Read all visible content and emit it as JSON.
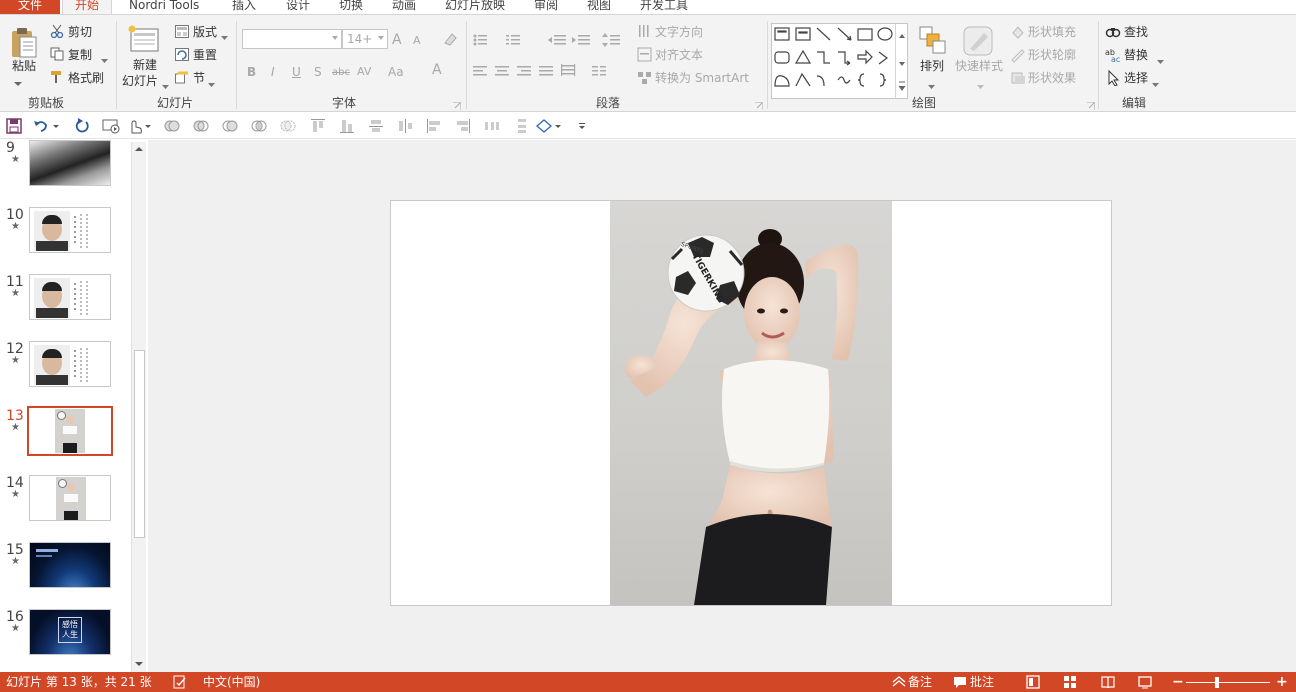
{
  "tabs": {
    "file": "文件",
    "home": "开始",
    "nordri": "Nordri Tools",
    "insert": "插入",
    "design": "设计",
    "transitions": "切换",
    "animations": "动画",
    "slideshow": "幻灯片放映",
    "review": "审阅",
    "view": "视图",
    "developer": "开发工具"
  },
  "clipboard": {
    "paste": "粘贴",
    "cut": "剪切",
    "copy": "复制",
    "format_painter": "格式刷",
    "group": "剪贴板"
  },
  "slides_group": {
    "new_slide_line1": "新建",
    "new_slide_line2": "幻灯片",
    "layout": "版式",
    "reset": "重置",
    "section": "节",
    "group": "幻灯片"
  },
  "font": {
    "size": "14+",
    "group": "字体",
    "bold": "B",
    "italic": "I",
    "underline": "U",
    "shadow": "S",
    "strike": "abc",
    "spacing": "AV",
    "case": "Aa",
    "color": "A",
    "grow": "A",
    "shrink": "A"
  },
  "paragraph": {
    "text_direction": "文字方向",
    "align_text": "对齐文本",
    "smartart": "转换为 SmartArt",
    "group": "段落"
  },
  "drawing": {
    "arrange": "排列",
    "quick_styles": "快速样式",
    "shape_fill": "形状填充",
    "shape_outline": "形状轮廓",
    "shape_effects": "形状效果",
    "group": "绘图"
  },
  "editing": {
    "find": "查找",
    "replace": "替换",
    "select": "选择",
    "group": "编辑"
  },
  "thumbnails": [
    {
      "num": "9",
      "star": "★",
      "kind": "dark"
    },
    {
      "num": "10",
      "star": "★",
      "kind": "portrait"
    },
    {
      "num": "11",
      "star": "★",
      "kind": "portrait"
    },
    {
      "num": "12",
      "star": "★",
      "kind": "portrait"
    },
    {
      "num": "13",
      "star": "★",
      "kind": "photo",
      "active": true
    },
    {
      "num": "14",
      "star": "★",
      "kind": "photo"
    },
    {
      "num": "15",
      "star": "★",
      "kind": "space"
    },
    {
      "num": "16",
      "star": "★",
      "kind": "space2"
    }
  ],
  "slide16_text": "感悟\n人生",
  "photo_ball_text": "TIGERKING",
  "photo_ball_sub": "SPORTS",
  "status": {
    "slide_info": "幻灯片 第 13 张，共 21 张",
    "language": "中文(中国)",
    "notes": "备注",
    "comments": "批注"
  },
  "colors": {
    "accent": "#d24726",
    "ribbon_bg": "#f3f3f3",
    "canvas_bg": "#f0f0f0"
  }
}
